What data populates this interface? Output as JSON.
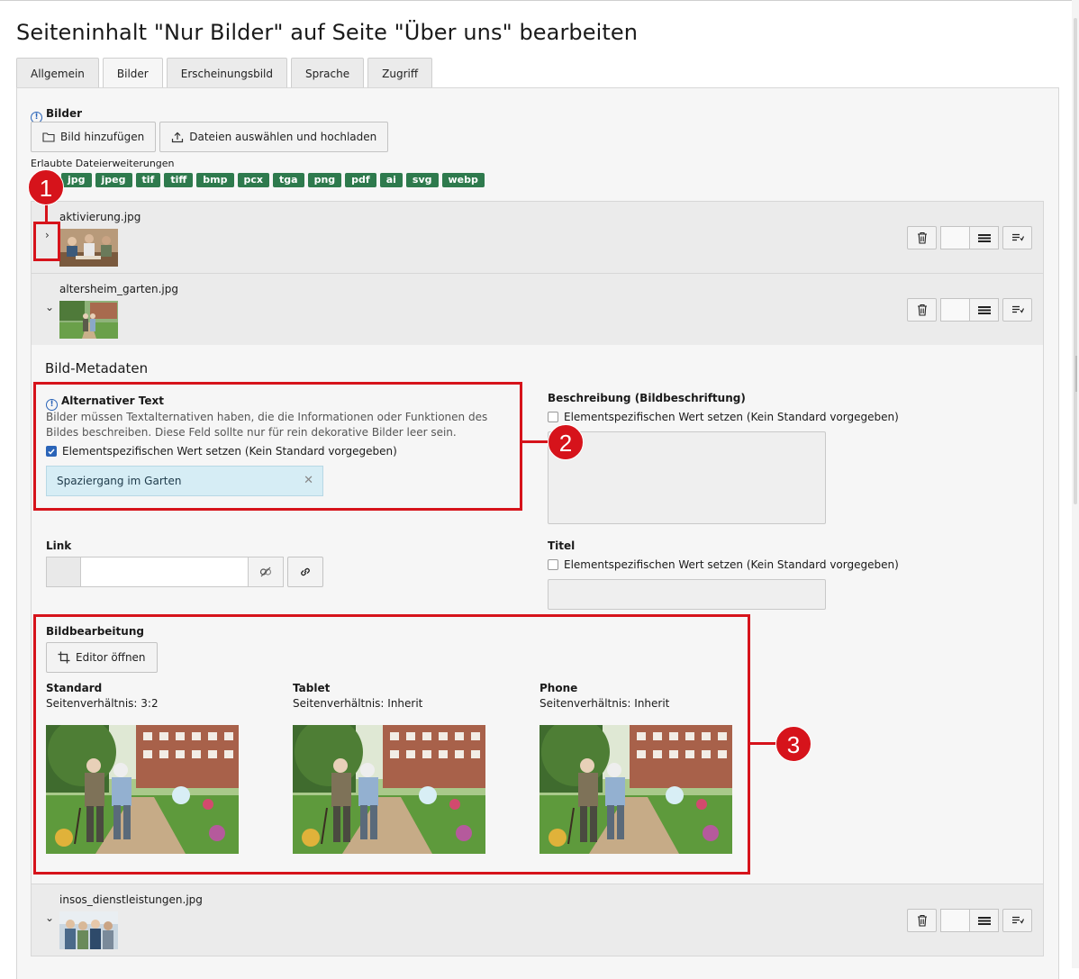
{
  "page_title": "Seiteninhalt \"Nur Bilder\" auf Seite \"Über uns\" bearbeiten",
  "tabs": [
    {
      "label": "Allgemein"
    },
    {
      "label": "Bilder"
    },
    {
      "label": "Erscheinungsbild"
    },
    {
      "label": "Sprache"
    },
    {
      "label": "Zugriff"
    }
  ],
  "bilder": {
    "label": "Bilder",
    "add_button": "Bild hinzufügen",
    "upload_button": "Dateien auswählen und hochladen",
    "allowed_ext_label": "Erlaubte Dateierweiterungen",
    "extensions": [
      "jpg",
      "jpeg",
      "tif",
      "tiff",
      "bmp",
      "pcx",
      "tga",
      "png",
      "pdf",
      "ai",
      "svg",
      "webp"
    ]
  },
  "files": [
    {
      "name": "aktivierung.jpg",
      "toggle": "›"
    },
    {
      "name": "altersheim_garten.jpg",
      "toggle": "⌄"
    },
    {
      "name": "insos_dienstleistungen.jpg",
      "toggle": "⌄"
    }
  ],
  "metadata": {
    "heading": "Bild-Metadaten",
    "alt_label": "Alternativer Text",
    "alt_description": "Bilder müssen Textalternativen haben, die die Informationen oder Funktionen des Bildes beschreiben. Diese Feld sollte nur für rein dekorative Bilder leer sein.",
    "alt_checkbox": "Elementspezifischen Wert setzen (Kein Standard vorgegeben)",
    "alt_checked": true,
    "alt_value": "Spaziergang im Garten",
    "beschreibung_label": "Beschreibung (Bildbeschriftung)",
    "beschreibung_checkbox": "Elementspezifischen Wert setzen (Kein Standard vorgegeben)",
    "link_label": "Link",
    "titel_label": "Titel",
    "titel_checkbox": "Elementspezifischen Wert setzen (Kein Standard vorgegeben)"
  },
  "bildbearbeitung": {
    "label": "Bildbearbeitung",
    "editor_button": "Editor öffnen",
    "crops": [
      {
        "name": "Standard",
        "ratio": "Seitenverhältnis: 3:2"
      },
      {
        "name": "Tablet",
        "ratio": "Seitenverhältnis: Inherit"
      },
      {
        "name": "Phone",
        "ratio": "Seitenverhältnis: Inherit"
      }
    ]
  },
  "annotations": [
    "1",
    "2",
    "3"
  ],
  "colors": {
    "accent_red": "#d6131b",
    "ext_badge": "#2e7a4d",
    "info_blue": "#2a64b8"
  }
}
